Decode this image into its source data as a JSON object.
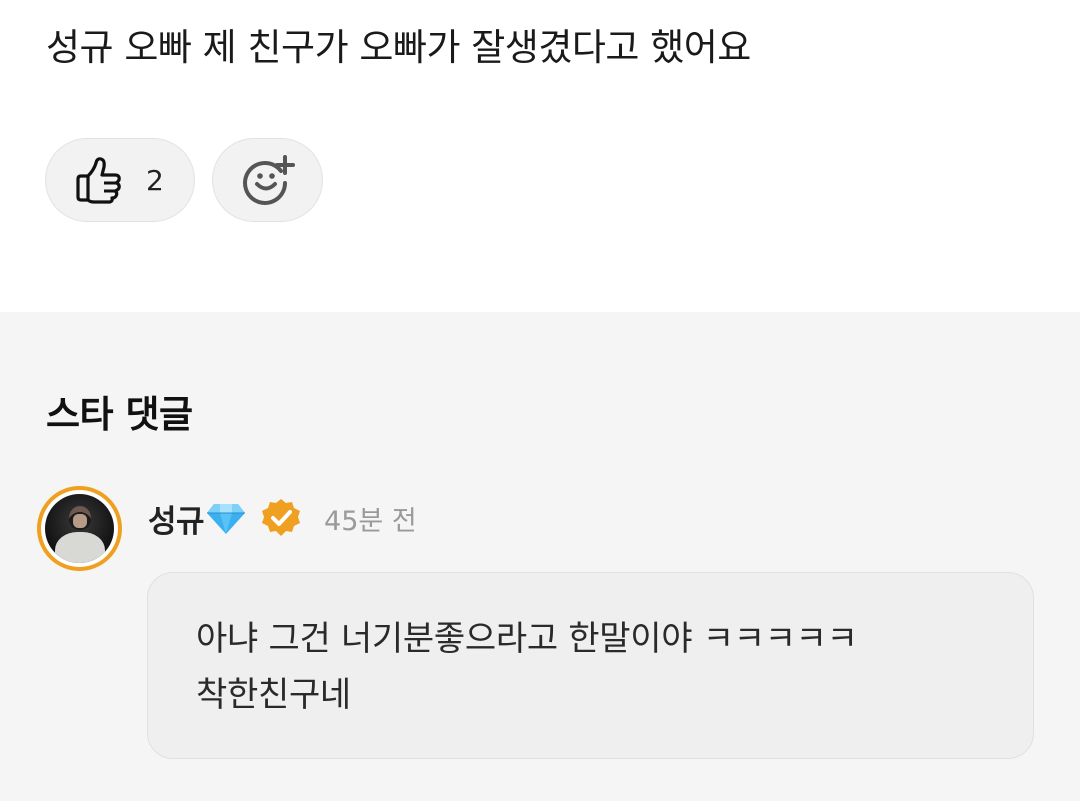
{
  "post": {
    "text": "성규 오빠 제 친구가 오빠가 잘생겼다고 했어요",
    "like_count": "2"
  },
  "comments_section": {
    "title": "스타 댓글",
    "comment": {
      "author": "성규",
      "time": "45분 전",
      "body": "아냐 그건 너기분좋으라고 한말이야 ㅋㅋㅋㅋㅋ 착한친구네"
    }
  },
  "icons": {
    "like": "thumbs-up-icon",
    "add_reaction": "add-emoji-icon",
    "diamond": "diamond-emoji-icon",
    "verified": "verified-badge-icon"
  },
  "colors": {
    "accent": "#f0a020",
    "diamond": "#3ab0f0",
    "section_bg": "#f5f5f5"
  }
}
